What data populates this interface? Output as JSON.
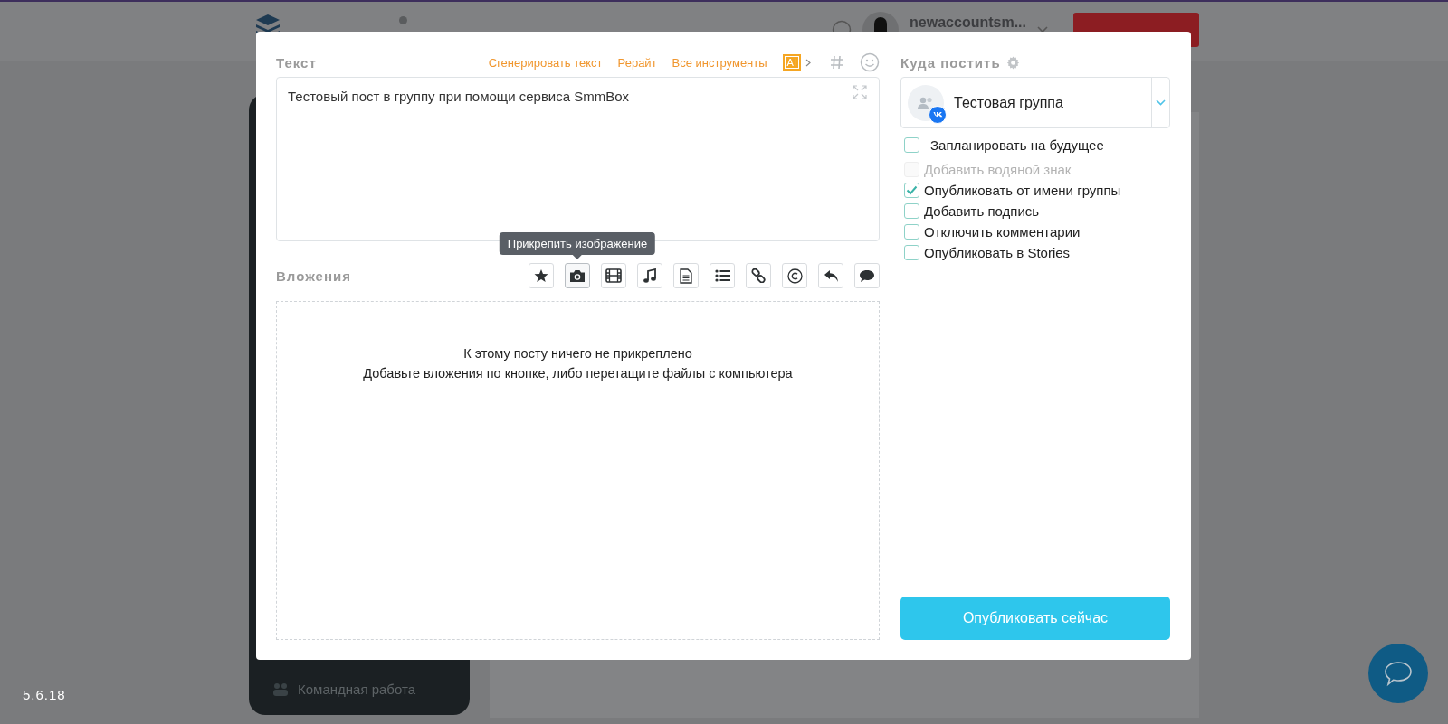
{
  "header": {
    "username": "newaccountsm..."
  },
  "sidebar": {
    "items": [
      {
        "label": "Командная работа"
      }
    ]
  },
  "version": "5.6.18",
  "modal": {
    "text_section": {
      "label": "Текст",
      "tools": [
        "Сгенерировать текст",
        "Рерайт",
        "Все инструменты"
      ],
      "ai_badge": "AI",
      "value": "Тестовый пост в группу при помощи сервиса SmmBox"
    },
    "attachments": {
      "label": "Вложения",
      "tooltip": "Прикрепить изображение",
      "buttons": [
        {
          "kind": "star",
          "hovered": false
        },
        {
          "kind": "camera",
          "hovered": true
        },
        {
          "kind": "film",
          "hovered": false
        },
        {
          "kind": "music",
          "hovered": false
        },
        {
          "kind": "document",
          "hovered": false
        },
        {
          "kind": "list",
          "hovered": false
        },
        {
          "kind": "link",
          "hovered": false
        },
        {
          "kind": "copyright",
          "hovered": false
        },
        {
          "kind": "reply",
          "hovered": false
        },
        {
          "kind": "comment",
          "hovered": false
        }
      ],
      "empty_title": "К этому посту ничего не прикреплено",
      "empty_hint": "Добавьте вложения по кнопке, либо перетащите файлы с компьютера"
    },
    "target": {
      "label": "Куда постить",
      "group": "Тестовая группа",
      "options": [
        {
          "label": "Запланировать на будущее",
          "checked": false,
          "disabled": false
        },
        {
          "label": "Добавить водяной знак",
          "checked": false,
          "disabled": true
        },
        {
          "label": "Опубликовать от имени группы",
          "checked": true,
          "disabled": false
        },
        {
          "label": "Добавить подпись",
          "checked": false,
          "disabled": false
        },
        {
          "label": "Отключить комментарии",
          "checked": false,
          "disabled": false
        },
        {
          "label": "Опубликовать в Stories",
          "checked": false,
          "disabled": false
        }
      ]
    },
    "publish_button": "Опубликовать сейчас"
  }
}
